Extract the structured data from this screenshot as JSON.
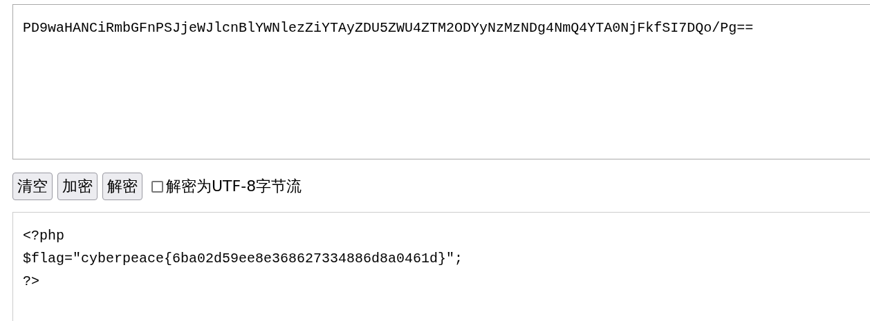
{
  "input": {
    "value": "PD9waHANCiRmbGFnPSJjeWJlcnBlYWNlezZiYTAyZDU5ZWU4ZTM2ODYyNzMzNDg4NmQ4YTA0NjFkfSI7DQo/Pg=="
  },
  "buttons": [
    "清空",
    "加密",
    "解密"
  ],
  "checkbox": {
    "label": "解密为UTF-8字节流",
    "checked": false
  },
  "output": {
    "lines": [
      "<?php",
      "$flag=\"cyberpeace{6ba02d59ee8e368627334886d8a0461d}\";",
      "?>"
    ]
  }
}
